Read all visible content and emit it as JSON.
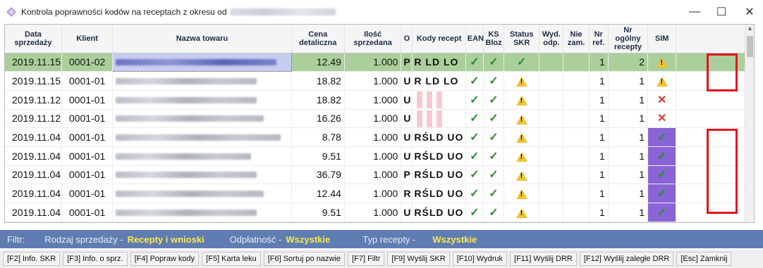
{
  "window": {
    "title": "Kontrola poprawności kodów na receptach z okresu od",
    "minimize": "—",
    "maximize": "☐",
    "close": "✕"
  },
  "columns": [
    "Data sprzedaży",
    "Klient",
    "Nazwa towaru",
    "Cena detaliczna",
    "Ilość sprzedana",
    "O",
    "Kody recept",
    "EAN",
    "KS Bloz",
    "Status SKR",
    "Wyd. odp.",
    "Nie zam.",
    "Nr ref.",
    "Nr ogólny recepty",
    "SIM"
  ],
  "rows": [
    {
      "date": "2019.11.15",
      "client": "0001-02",
      "price": "12.49",
      "qty": "1.000",
      "o": "P",
      "kody": "R LD LO",
      "ean": "check",
      "ks": "check",
      "status": "check",
      "nr_ref": "1",
      "nr_og": "2",
      "sim": "warn"
    },
    {
      "date": "2019.11.15",
      "client": "0001-01",
      "price": "18.82",
      "qty": "1.000",
      "o": "U",
      "kody": "R LD LO",
      "ean": "check",
      "ks": "check",
      "status": "warn",
      "nr_ref": "1",
      "nr_og": "1",
      "sim": "warn"
    },
    {
      "date": "2019.11.12",
      "client": "0001-01",
      "price": "18.82",
      "qty": "1.000",
      "o": "U",
      "kody": "",
      "ean": "check",
      "ks": "check",
      "status": "warn",
      "nr_ref": "1",
      "nr_og": "1",
      "sim": "cross"
    },
    {
      "date": "2019.11.12",
      "client": "0001-01",
      "price": "16.26",
      "qty": "1.000",
      "o": "U",
      "kody": "",
      "ean": "check",
      "ks": "check",
      "status": "warn",
      "nr_ref": "1",
      "nr_og": "1",
      "sim": "cross"
    },
    {
      "date": "2019.11.04",
      "client": "0001-01",
      "price": "8.78",
      "qty": "1.000",
      "o": "U",
      "kody": "RŚLD UO",
      "ean": "check",
      "ks": "check",
      "status": "warn",
      "nr_ref": "1",
      "nr_og": "1",
      "sim": "check"
    },
    {
      "date": "2019.11.04",
      "client": "0001-01",
      "price": "9.51",
      "qty": "1.000",
      "o": "U",
      "kody": "RŚLD UO",
      "ean": "check",
      "ks": "check",
      "status": "warn",
      "nr_ref": "1",
      "nr_og": "1",
      "sim": "check"
    },
    {
      "date": "2019.11.04",
      "client": "0001-01",
      "price": "36.79",
      "qty": "1.000",
      "o": "P",
      "kody": "RŚLD UO",
      "ean": "check",
      "ks": "check",
      "status": "warn",
      "nr_ref": "1",
      "nr_og": "1",
      "sim": "check"
    },
    {
      "date": "2019.11.04",
      "client": "0001-01",
      "price": "12.44",
      "qty": "1.000",
      "o": "R",
      "kody": "RŚLD UO",
      "ean": "check",
      "ks": "check",
      "status": "warn",
      "nr_ref": "1",
      "nr_og": "1",
      "sim": "check"
    },
    {
      "date": "2019.11.04",
      "client": "0001-01",
      "price": "9.51",
      "qty": "1.000",
      "o": "U",
      "kody": "RŚLD UO",
      "ean": "check",
      "ks": "check",
      "status": "warn",
      "nr_ref": "1",
      "nr_og": "1",
      "sim": "check"
    }
  ],
  "filter": {
    "label": "Filtr:",
    "sale_type_label": "Rodzaj sprzedaży -",
    "sale_type_value": "Recepty i wnioski",
    "payment_label": "Odpłatność -",
    "payment_value": "Wszystkie",
    "rx_type_label": "Typ recepty -",
    "rx_type_value": "Wszystkie"
  },
  "buttons": [
    "[F2] Info. SKR",
    "[F3] Info. o sprz.",
    "[F4] Popraw kody",
    "[F5] Karta leku",
    "[F6] Sortuj po nazwie",
    "[F7] Filtr",
    "[F9] Wyślij SKR",
    "[F10] Wydruk",
    "[F11] Wyślij DRR",
    "[F12] Wyślij zaległe DRR",
    "[Esc] Zamknij"
  ],
  "colors": {
    "selected_row": "#aacf9b",
    "filter_bar": "#5f7db2",
    "filter_value": "#ffe74a",
    "sim_highlight": "#8a63d6",
    "red_outline": "#e0141e"
  }
}
